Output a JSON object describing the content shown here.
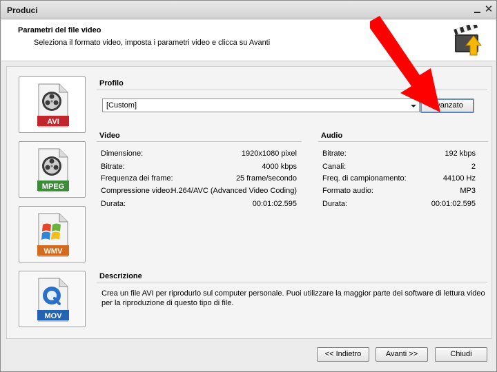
{
  "window": {
    "title": "Produci"
  },
  "header": {
    "title": "Parametri del file video",
    "subtitle": "Seleziona il formato video, imposta i parametri video e clicca su Avanti"
  },
  "formats": [
    {
      "label": "AVI",
      "color": "#c0262b"
    },
    {
      "label": "MPEG",
      "color": "#3d8b38"
    },
    {
      "label": "WMV",
      "color": "#d36a1e"
    },
    {
      "label": "MOV",
      "color": "#2462b4"
    }
  ],
  "profile": {
    "title": "Profilo",
    "value": "[Custom]",
    "advanced_label": "Avanzato"
  },
  "video": {
    "title": "Video",
    "rows": [
      {
        "k": "Dimensione:",
        "v": "1920x1080 pixel"
      },
      {
        "k": "Bitrate:",
        "v": "4000 kbps"
      },
      {
        "k": "Frequenza dei frame:",
        "v": "25 frame/secondo"
      },
      {
        "k": "Compressione video:",
        "v": "H.264/AVC (Advanced Video Coding)"
      },
      {
        "k": "Durata:",
        "v": "00:01:02.595"
      }
    ]
  },
  "audio": {
    "title": "Audio",
    "rows": [
      {
        "k": "Bitrate:",
        "v": "192 kbps"
      },
      {
        "k": "Canali:",
        "v": "2"
      },
      {
        "k": "Freq. di campionamento:",
        "v": "44100 Hz"
      },
      {
        "k": "Formato audio:",
        "v": "MP3"
      },
      {
        "k": "Durata:",
        "v": "00:01:02.595"
      }
    ]
  },
  "description": {
    "title": "Descrizione",
    "text": "Crea un file AVI per riprodurlo sul computer personale. Puoi utilizzare la maggior parte dei software di lettura video per la riproduzione di questo tipo di file."
  },
  "footer": {
    "back_label": "<< Indietro",
    "next_label": "Avanti >>",
    "close_label": "Chiudi"
  },
  "annotation": {
    "arrow_color": "#ff0000"
  }
}
